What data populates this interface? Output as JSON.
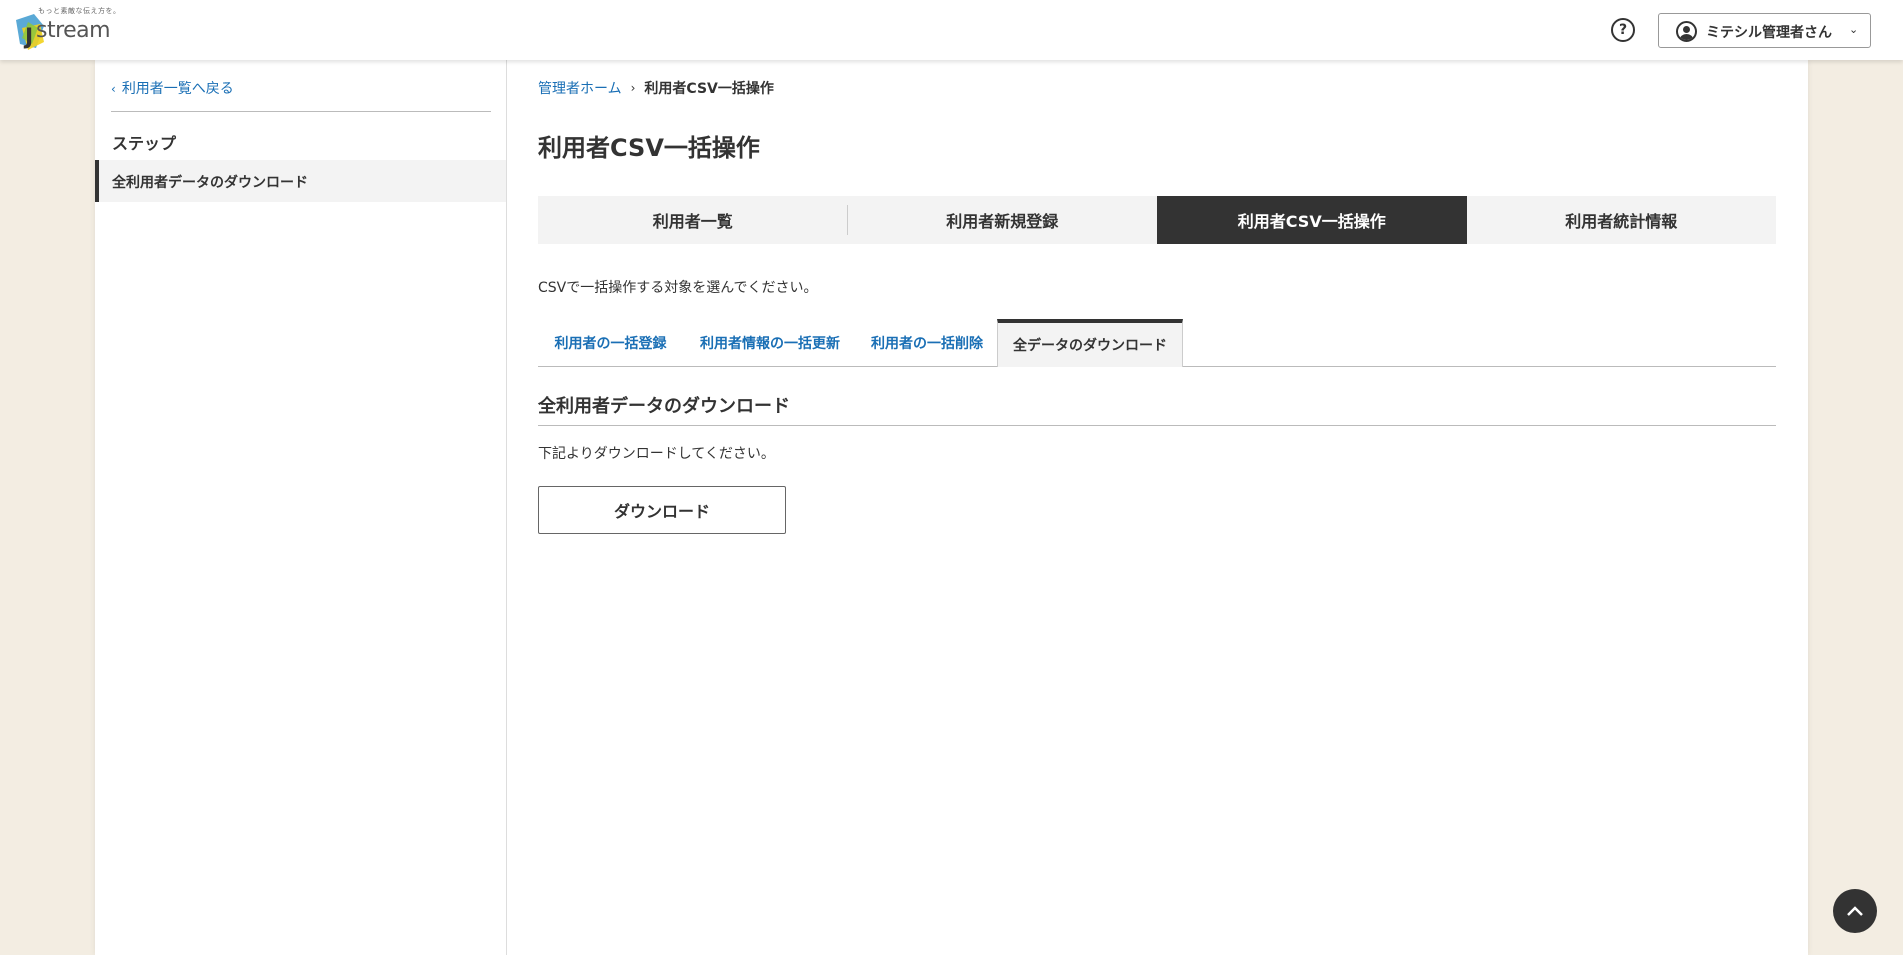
{
  "header": {
    "logo_tagline": "もっと素敵な伝え方を。",
    "logo_text": "stream",
    "logo_letter": "J",
    "help_icon": "help-circle-icon",
    "user_name": "ミテシル管理者さん"
  },
  "sidebar": {
    "back_label": "利用者一覧へ戻る",
    "steps_heading": "ステップ",
    "steps": [
      {
        "label": "全利用者データのダウンロード",
        "active": true
      }
    ]
  },
  "breadcrumb": {
    "home": "管理者ホーム",
    "current": "利用者CSV一括操作"
  },
  "page_title": "利用者CSV一括操作",
  "main_tabs": [
    {
      "label": "利用者一覧",
      "active": false
    },
    {
      "label": "利用者新規登録",
      "active": false
    },
    {
      "label": "利用者CSV一括操作",
      "active": true
    },
    {
      "label": "利用者統計情報",
      "active": false
    }
  ],
  "instruction": "CSVで一括操作する対象を選んでください。",
  "sub_tabs": [
    {
      "label": "利用者の一括登録",
      "active": false
    },
    {
      "label": "利用者情報の一括更新",
      "active": false
    },
    {
      "label": "利用者の一括削除",
      "active": false
    },
    {
      "label": "全データのダウンロード",
      "active": true
    }
  ],
  "section": {
    "heading": "全利用者データのダウンロード",
    "description": "下記よりダウンロードしてください。",
    "button_label": "ダウンロード"
  },
  "colors": {
    "accent_link": "#1a6fb5",
    "active_tab_bg": "#333333",
    "page_bg": "#f3ede2"
  }
}
